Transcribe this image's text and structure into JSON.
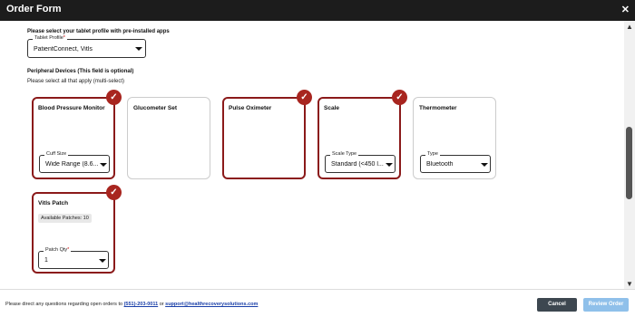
{
  "window": {
    "title": "Order Form",
    "close": "✕"
  },
  "tablet": {
    "heading": "Please select your tablet profile with pre-installed apps",
    "legend": "Tablet Profile",
    "required_mark": "*",
    "value": "PatientConnect, Vitls"
  },
  "peripheral": {
    "heading": "Peripheral Devices (This field is optional)",
    "subheading": "Please select all that apply (multi-select)"
  },
  "devices": [
    {
      "title": "Blood Pressure Monitor",
      "selected": true,
      "field_legend": "Cuff Size",
      "field_value": "Wide Range (8.6..."
    },
    {
      "title": "Glucometer Set",
      "selected": false
    },
    {
      "title": "Pulse Oximeter",
      "selected": true
    },
    {
      "title": "Scale",
      "selected": true,
      "field_legend": "Scale Type",
      "field_value": "Standard (<450 l..."
    },
    {
      "title": "Thermometer",
      "selected": false,
      "field_legend": "Type",
      "field_value": "Bluetooth"
    },
    {
      "title": "Vitls Patch",
      "selected": true,
      "chip": "Available Patches: 10",
      "field_legend": "Patch Qty",
      "required_mark": "*",
      "field_value": "1"
    }
  ],
  "check_glyph": "✓",
  "footer": {
    "note_prefix": "Please direct any questions regarding open orders to ",
    "phone": "(551)-203-0011",
    "note_mid": " or ",
    "email": "support@healthrecoverysolutions.com",
    "cancel_label": "Cancel",
    "review_label": "Review Order"
  },
  "colors": {
    "accent": "#a8251f",
    "titlebar": "#1c1c1c",
    "cancel": "#3d4750",
    "review": "#8fc0ea"
  }
}
